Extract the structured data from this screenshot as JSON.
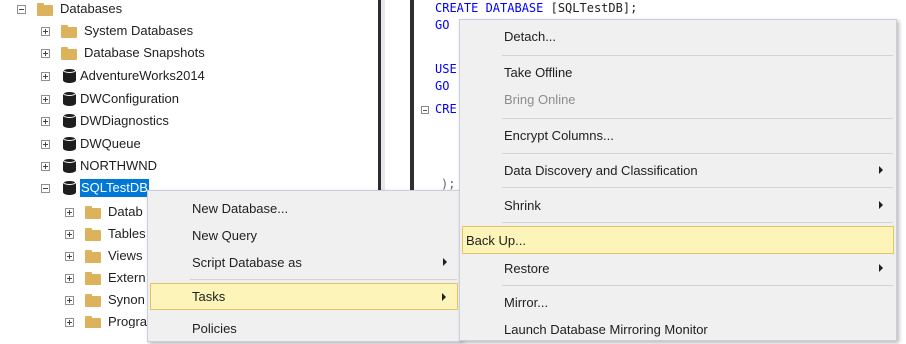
{
  "tree": {
    "databases_label": "Databases",
    "items": [
      {
        "label": "System Databases"
      },
      {
        "label": "Database Snapshots"
      },
      {
        "label": "AdventureWorks2014"
      },
      {
        "label": "DWConfiguration"
      },
      {
        "label": "DWDiagnostics"
      },
      {
        "label": "DWQueue"
      },
      {
        "label": "NORTHWND"
      },
      {
        "label": "SQLTestDB"
      }
    ],
    "children": [
      {
        "label": "Datab"
      },
      {
        "label": "Tables"
      },
      {
        "label": "Views"
      },
      {
        "label": "Extern"
      },
      {
        "label": "Synon"
      },
      {
        "label": "Progra"
      }
    ]
  },
  "editor": {
    "line1_kw": "CREATE DATABASE",
    "line1_rest": " [SQLTestDB];",
    "line2": "GO",
    "line3": "USE",
    "line4": "GO",
    "line5": "CRE",
    "line6": ");"
  },
  "context_menu": {
    "items": [
      {
        "label": "New Database..."
      },
      {
        "label": "New Query"
      },
      {
        "label": "Script Database as"
      },
      {
        "label": "Tasks"
      },
      {
        "label": "Policies"
      }
    ]
  },
  "tasks_menu": {
    "items": [
      {
        "label": "Detach..."
      },
      {
        "label": "Take Offline"
      },
      {
        "label": "Bring Online"
      },
      {
        "label": "Encrypt Columns..."
      },
      {
        "label": "Data Discovery and Classification"
      },
      {
        "label": "Shrink"
      },
      {
        "label": "Back Up..."
      },
      {
        "label": "Restore"
      },
      {
        "label": "Mirror..."
      },
      {
        "label": "Launch Database Mirroring Monitor"
      }
    ]
  },
  "colors": {
    "selection": "#0078d7",
    "menu_highlight": "#fcf4b8",
    "folder": "#dcb35c",
    "keyword": "#0000ff"
  }
}
